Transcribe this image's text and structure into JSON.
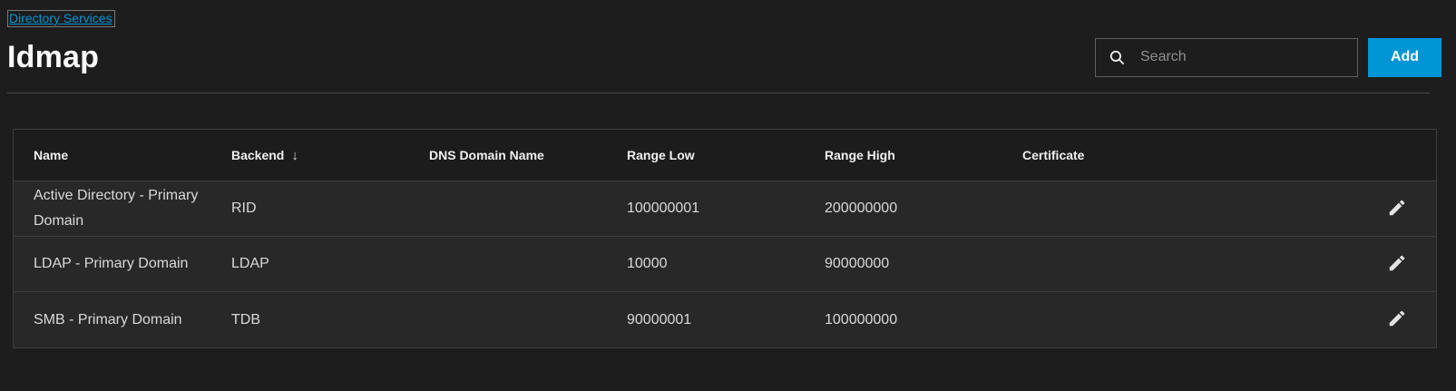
{
  "page": {
    "breadcrumb": "Directory Services",
    "title": "Idmap"
  },
  "toolbar": {
    "search_placeholder": "Search",
    "search_value": "",
    "add_label": "Add"
  },
  "table": {
    "columns": {
      "name": "Name",
      "backend": "Backend",
      "dns_domain_name": "DNS Domain Name",
      "range_low": "Range Low",
      "range_high": "Range High",
      "certificate": "Certificate"
    },
    "sort": {
      "column": "Backend",
      "direction": "descending",
      "arrow_glyph": "↓"
    },
    "rows": [
      {
        "name": "Active Directory - Primary Domain",
        "backend": "RID",
        "dns_domain_name": "",
        "range_low": "100000001",
        "range_high": "200000000",
        "certificate": ""
      },
      {
        "name": "LDAP - Primary Domain",
        "backend": "LDAP",
        "dns_domain_name": "",
        "range_low": "10000",
        "range_high": "90000000",
        "certificate": ""
      },
      {
        "name": "SMB - Primary Domain",
        "backend": "TDB",
        "dns_domain_name": "",
        "range_low": "90000001",
        "range_high": "100000000",
        "certificate": ""
      }
    ]
  },
  "icons": {
    "search": "magnifier-icon",
    "row_action": "pencil-edit-icon"
  },
  "colors": {
    "accent_blue": "#0095d5",
    "page_background": "#1d1d1d",
    "row_background": "#282828",
    "header_row_background": "#1c1c1c",
    "border": "#3d3d3d"
  }
}
